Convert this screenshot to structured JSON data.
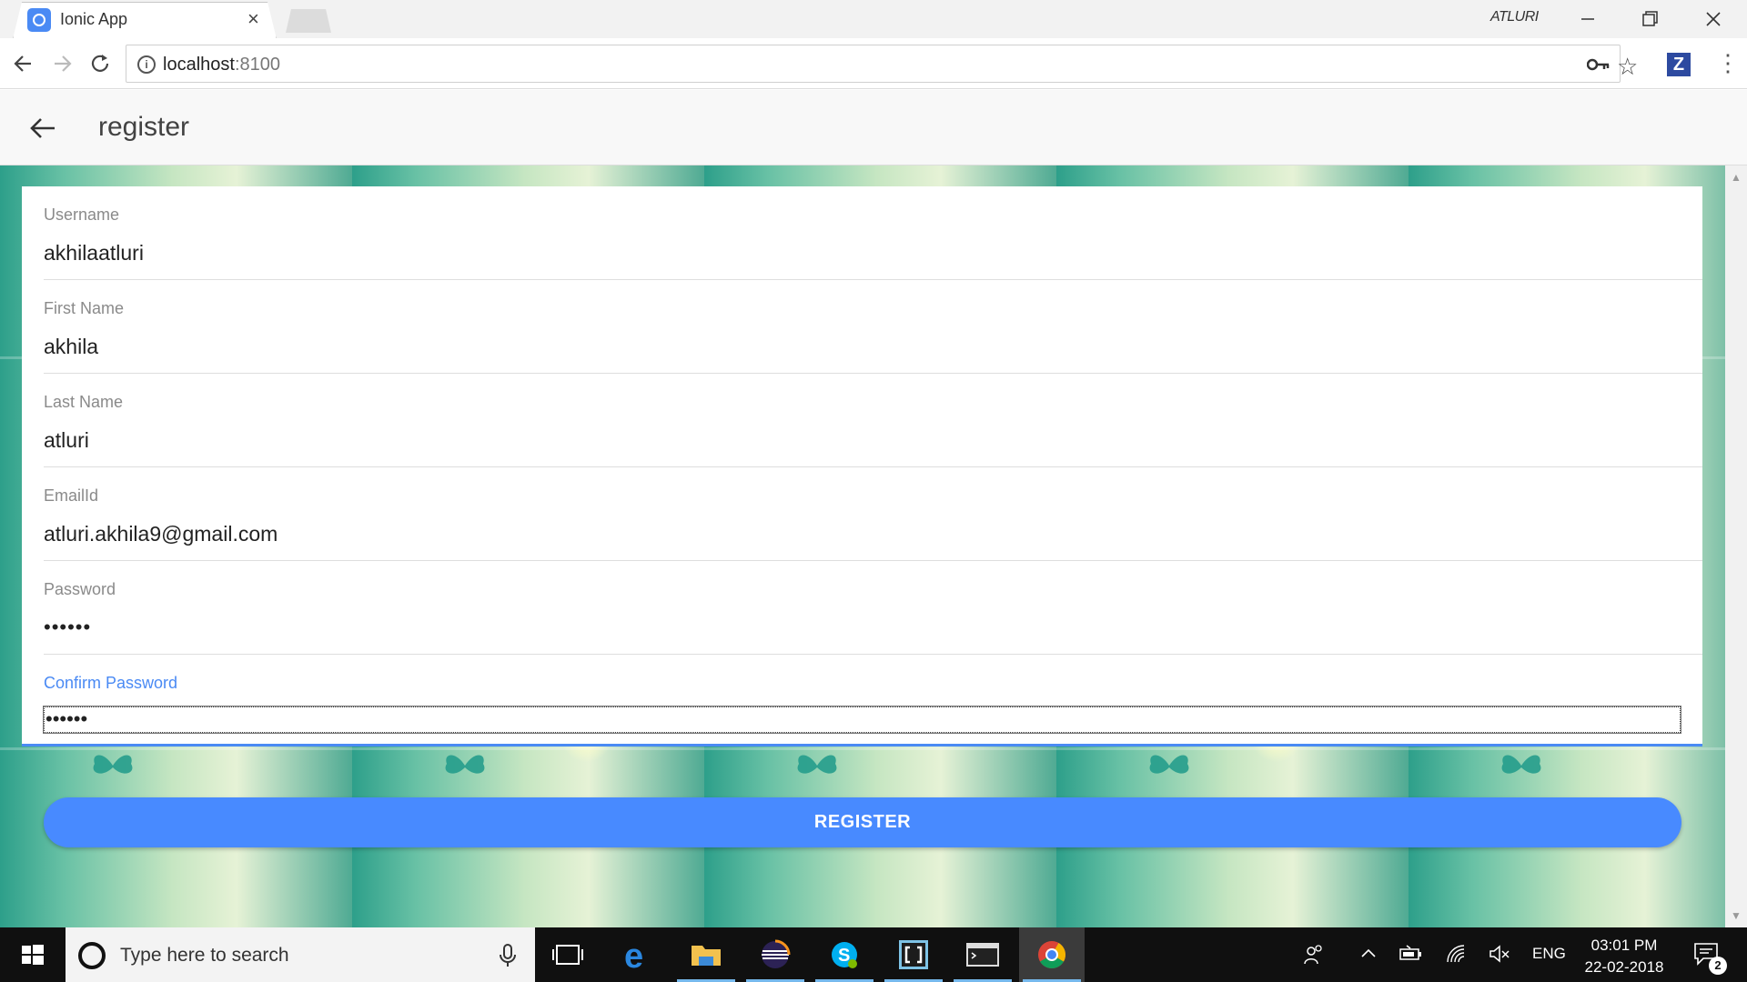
{
  "browser": {
    "tab_title": "Ionic App",
    "tab_close": "×",
    "window_user": "ATLURI",
    "url_host": "localhost",
    "url_port": ":8100",
    "extension_label": "Z"
  },
  "app": {
    "title": "register"
  },
  "form": {
    "fields": [
      {
        "label": "Username",
        "value": "akhilaatluri"
      },
      {
        "label": "First Name",
        "value": "akhila"
      },
      {
        "label": "Last Name",
        "value": "atluri"
      },
      {
        "label": "EmailId",
        "value": "atluri.akhila9@gmail.com"
      },
      {
        "label": "Password",
        "value": "••••••"
      },
      {
        "label": "Confirm Password",
        "value": "••••••"
      }
    ],
    "submit_label": "REGISTER"
  },
  "taskbar": {
    "search_placeholder": "Type here to search",
    "language": "ENG",
    "time": "03:01 PM",
    "date": "22-02-2018",
    "notification_count": "2"
  },
  "colors": {
    "accent": "#488aff",
    "label_active": "#4a8af4"
  }
}
